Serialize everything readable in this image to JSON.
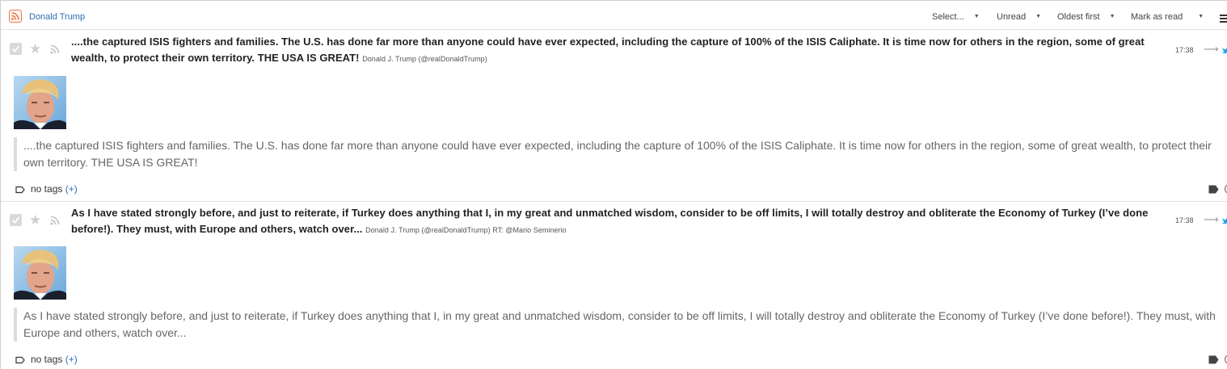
{
  "header": {
    "feed_title": "Donald Trump",
    "feed_icon": "rss-icon",
    "select_label": "Select...",
    "filter_label": "Unread",
    "sort_label": "Oldest first",
    "mark_label": "Mark as read",
    "menu_icon": "hamburger-menu-icon"
  },
  "entries": [
    {
      "title": "....the captured ISIS fighters and families. The U.S. has done far more than anyone could have ever expected, including the capture of 100% of the ISIS Caliphate. It is time now for others in the region, some of great wealth, to protect their own territory. THE USA IS GREAT!",
      "author": "Donald J. Trump (@realDonaldTrump)",
      "time": "17:38",
      "content": "....the captured ISIS fighters and families. The U.S. has done far more than anyone could have ever expected, including the capture of 100% of the ISIS Caliphate. It is time now for others in the region, some of great wealth, to protect their own territory. THE USA IS GREAT!",
      "tags_text": "no tags",
      "tags_add": "(+)"
    },
    {
      "title": "As I have stated strongly before, and just to reiterate, if Turkey does anything that I, in my great and unmatched wisdom, consider to be off limits, I will totally destroy and obliterate the Economy of Turkey (I’ve done before!). They must, with Europe and others, watch over...",
      "author": "Donald J. Trump (@realDonaldTrump) RT: @Mario Seminerio",
      "time": "17:38",
      "content": "As I have stated strongly before, and just to reiterate, if Turkey does anything that I, in my great and unmatched wisdom, consider to be off limits, I will totally destroy and obliterate the Economy of Turkey (I’ve done before!). They must, with Europe and others, watch over...",
      "tags_text": "no tags",
      "tags_add": "(+)"
    }
  ],
  "colors": {
    "link_blue": "#2b6db0",
    "twitter_blue": "#1da1f2",
    "rss_orange": "#e9784a"
  }
}
